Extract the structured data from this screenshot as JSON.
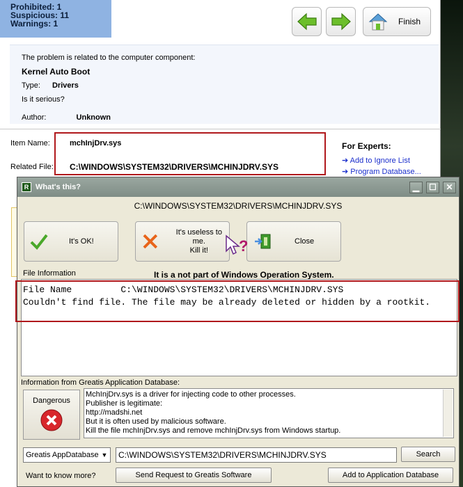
{
  "summary": {
    "prohibited": "Prohibited: 1",
    "suspicious": "Suspicious: 11",
    "warnings": "Warnings: 1"
  },
  "nav": {
    "finish_label": "Finish"
  },
  "problem": {
    "intro": "The problem is related to the computer component:",
    "component": "Kernel Auto Boot",
    "type_label": "Type:",
    "type_value": "Drivers",
    "serious": "Is it serious?",
    "author_label": "Author:",
    "author_value": "Unknown"
  },
  "item": {
    "name_label": "Item Name:",
    "name_value": "mchInjDrv.sys",
    "related_label": "Related File:",
    "related_value": "C:\\WINDOWS\\SYSTEM32\\DRIVERS\\MCHINJDRV.SYS"
  },
  "experts": {
    "heading": "For Experts:",
    "links": [
      "Add to Ignore List",
      "Program Database..."
    ]
  },
  "dialog": {
    "title": "What's this?",
    "path": "C:\\WINDOWS\\SYSTEM32\\DRIVERS\\MCHINJDRV.SYS",
    "ok_label": "It's OK!",
    "kill_label_1": "It's useless to me.",
    "kill_label_2": "Kill it!",
    "close_label": "Close",
    "file_info_label": "File Information",
    "not_part": "It is a not part of Windows Operation System.",
    "file_name_line": "File Name         C:\\WINDOWS\\SYSTEM32\\DRIVERS\\MCHINJDRV.SYS",
    "not_found_line": "Couldn't find file. The file may be already deleted or hidden by a rootkit.",
    "db_label": "Information from Greatis Application Database:",
    "danger_label": "Dangerous",
    "db_text": [
      "MchInjDrv.sys is a driver for injecting code to other processes.",
      "Publisher is legitimate:",
      "http://madshi.net",
      "But it is often used by malicious software.",
      "Kill the file mchInjDrv.sys and remove mchInjDrv.sys from Windows startup."
    ],
    "db_select": "Greatis AppDatabase",
    "search_value": "C:\\WINDOWS\\SYSTEM32\\DRIVERS\\MCHINJDRV.SYS",
    "search_button": "Search",
    "want_more": "Want to know more?",
    "send_request": "Send Request to Greatis Software",
    "add_db": "Add to Application Database"
  },
  "colors": {
    "accent_red": "#b0181c",
    "summary_bg": "#8fb3e2",
    "dialog_bg": "#ece9d8",
    "title_bar": "#8a978f",
    "link_blue": "#1a2ecc"
  }
}
